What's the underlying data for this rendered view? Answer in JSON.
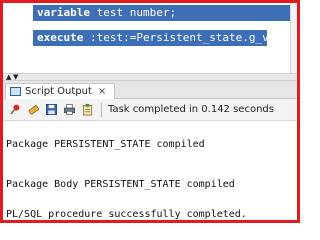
{
  "editor": {
    "lines": [
      {
        "keyword": "variable",
        "rest": " test number;"
      },
      {
        "keyword": "execute",
        "rest": " :test:=Persistent_state.g_var;"
      }
    ]
  },
  "splitter": {
    "up_glyph": "▲",
    "down_glyph": "▼"
  },
  "tab": {
    "label": "Script Output",
    "close_glyph": "×"
  },
  "toolbar": {
    "icons": [
      "pin-icon",
      "eraser-icon",
      "save-icon",
      "print-icon",
      "clipboard-icon"
    ],
    "status": "Task completed in 0.142 seconds"
  },
  "output": {
    "lines": [
      "Package PERSISTENT_STATE compiled",
      "Package Body PERSISTENT_STATE compiled",
      "PL/SQL procedure successfully completed."
    ]
  },
  "colors": {
    "frame": "#e21b23",
    "selection": "#3d6fb8"
  }
}
